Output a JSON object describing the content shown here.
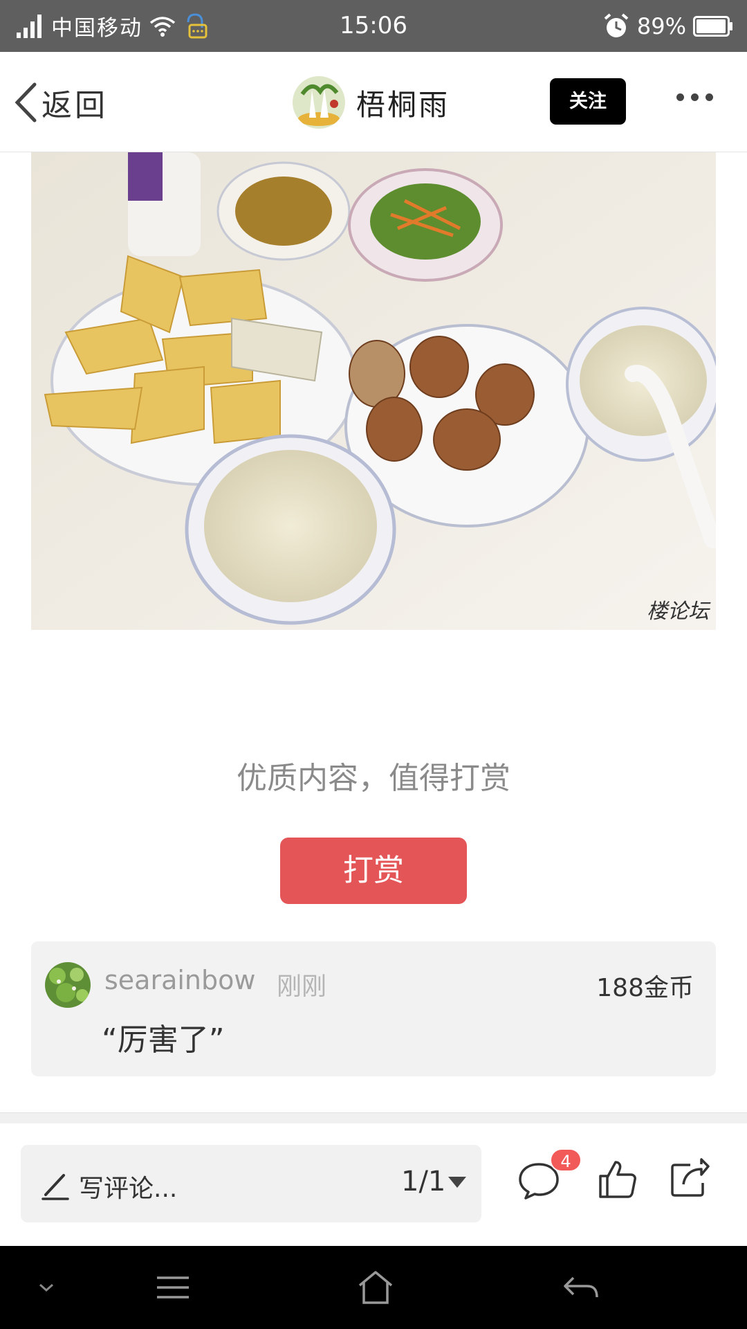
{
  "status_bar": {
    "carrier": "中国移动",
    "time": "15:06",
    "battery": "89%"
  },
  "header": {
    "back_label": "返回",
    "author_name": "梧桐雨",
    "follow_label": "关注"
  },
  "photo": {
    "watermark": "楼论坛"
  },
  "reward": {
    "prompt": "优质内容，值得打赏",
    "button_label": "打赏"
  },
  "reward_record": {
    "user": "searainbow",
    "time": "刚刚",
    "amount": "188金币",
    "comment": "“厉害了”"
  },
  "bottom_bar": {
    "comment_placeholder": "写评论...",
    "page_indicator": "1/1",
    "comment_count": "4"
  },
  "colors": {
    "status_bar": "#5f5f5f",
    "reward_button": "#e45557",
    "badge": "#f25a5a",
    "follow_button": "#000000"
  }
}
